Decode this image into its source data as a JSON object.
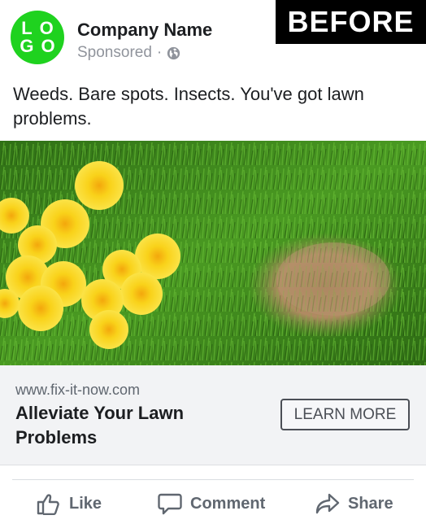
{
  "header": {
    "logo_line1": "LO",
    "logo_line2": "GO",
    "company_name": "Company Name",
    "sponsored": "Sponsored",
    "separator": "·",
    "privacy_icon": "globe-icon"
  },
  "badge": {
    "label": "BEFORE"
  },
  "post": {
    "caption": "Weeds. Bare spots. Insects. You've got lawn problems."
  },
  "link": {
    "domain": "www.fix-it-now.com",
    "headline": "Alleviate Your Lawn Problems",
    "cta": "LEARN MORE"
  },
  "actions": {
    "like": "Like",
    "comment": "Comment",
    "share": "Share"
  },
  "colors": {
    "logo_bg": "#1fd21f",
    "link_bar_bg": "#f2f3f5",
    "action_text": "#606770",
    "grass": "#3f8a1d",
    "dandelion": "#f6d316"
  }
}
